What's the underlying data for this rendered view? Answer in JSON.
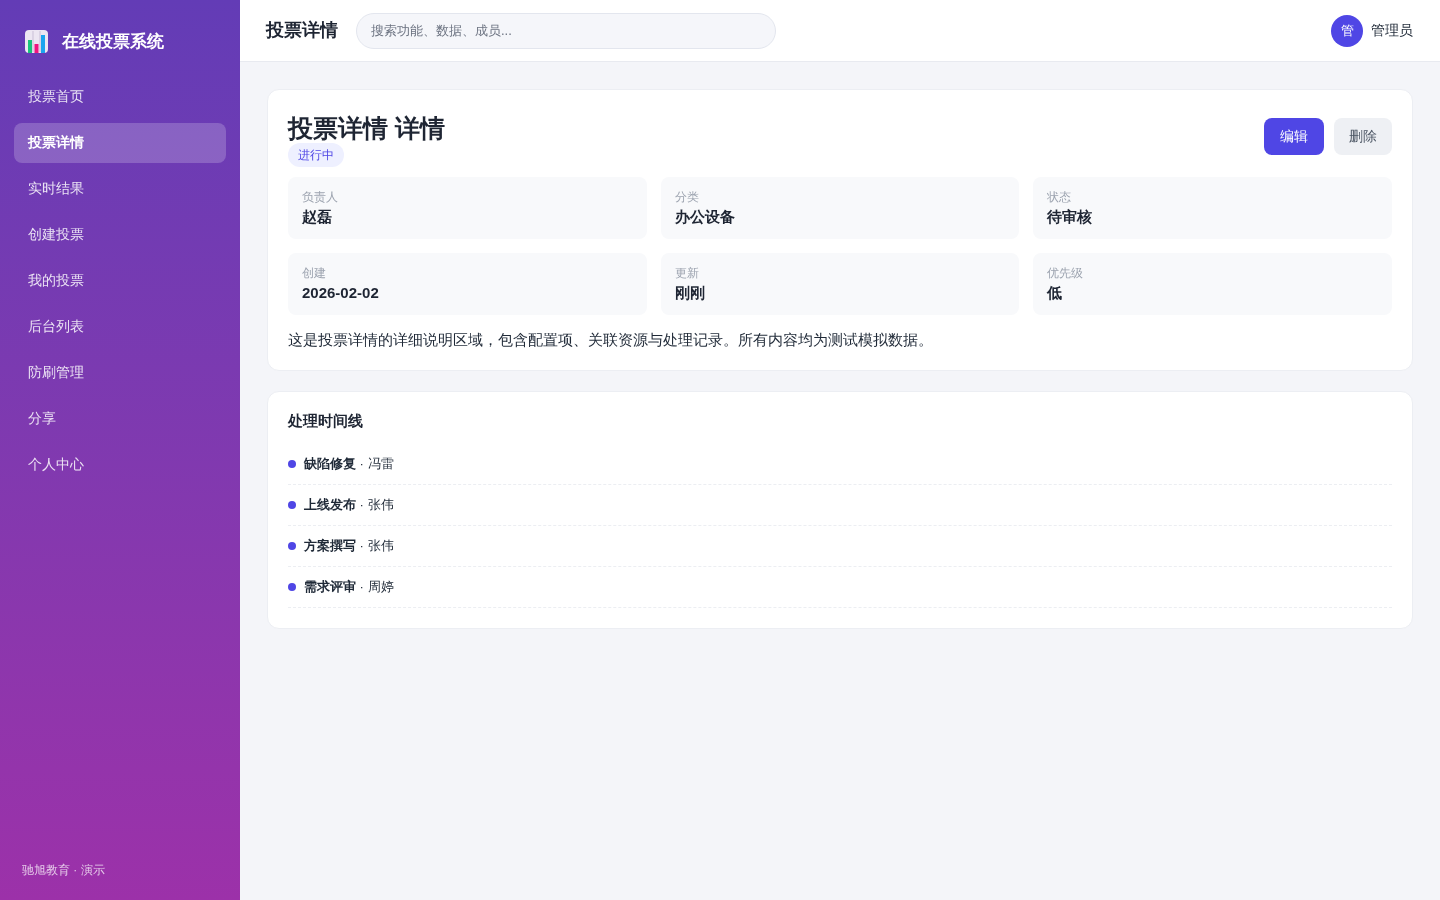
{
  "sidebar": {
    "brand": "在线投票系统",
    "items": [
      {
        "label": "投票首页",
        "selected": false
      },
      {
        "label": "投票详情",
        "selected": true
      },
      {
        "label": "实时结果",
        "selected": false
      },
      {
        "label": "创建投票",
        "selected": false
      },
      {
        "label": "我的投票",
        "selected": false
      },
      {
        "label": "后台列表",
        "selected": false
      },
      {
        "label": "防刷管理",
        "selected": false
      },
      {
        "label": "分享",
        "selected": false
      },
      {
        "label": "个人中心",
        "selected": false
      }
    ],
    "footer": "驰旭教育 · 演示"
  },
  "header": {
    "title": "投票详情",
    "search": {
      "placeholder": "搜索功能、数据、成员..."
    },
    "user": {
      "avatar": "管",
      "name": "管理员"
    }
  },
  "detail": {
    "title": "投票详情 详情",
    "status": "进行中",
    "buttons": [
      {
        "label": "编辑",
        "kind": "primary"
      },
      {
        "label": "删除",
        "kind": "secondary"
      }
    ],
    "fields": [
      {
        "label": "负责人",
        "value": "赵磊"
      },
      {
        "label": "分类",
        "value": "办公设备"
      },
      {
        "label": "状态",
        "value": "待审核"
      },
      {
        "label": "创建",
        "value": "2026-02-02"
      },
      {
        "label": "更新",
        "value": "刚刚"
      },
      {
        "label": "优先级",
        "value": "低"
      }
    ],
    "description": "这是投票详情的详细说明区域，包含配置项、关联资源与处理记录。所有内容均为测试模拟数据。"
  },
  "timeline": {
    "title": "处理时间线",
    "items": [
      {
        "text": "**缺陷修复** · 冯雷"
      },
      {
        "text": "**上线发布** · 张伟"
      },
      {
        "text": "**方案撰写** · 张伟"
      },
      {
        "text": "**需求评审** · 周婷"
      }
    ]
  }
}
